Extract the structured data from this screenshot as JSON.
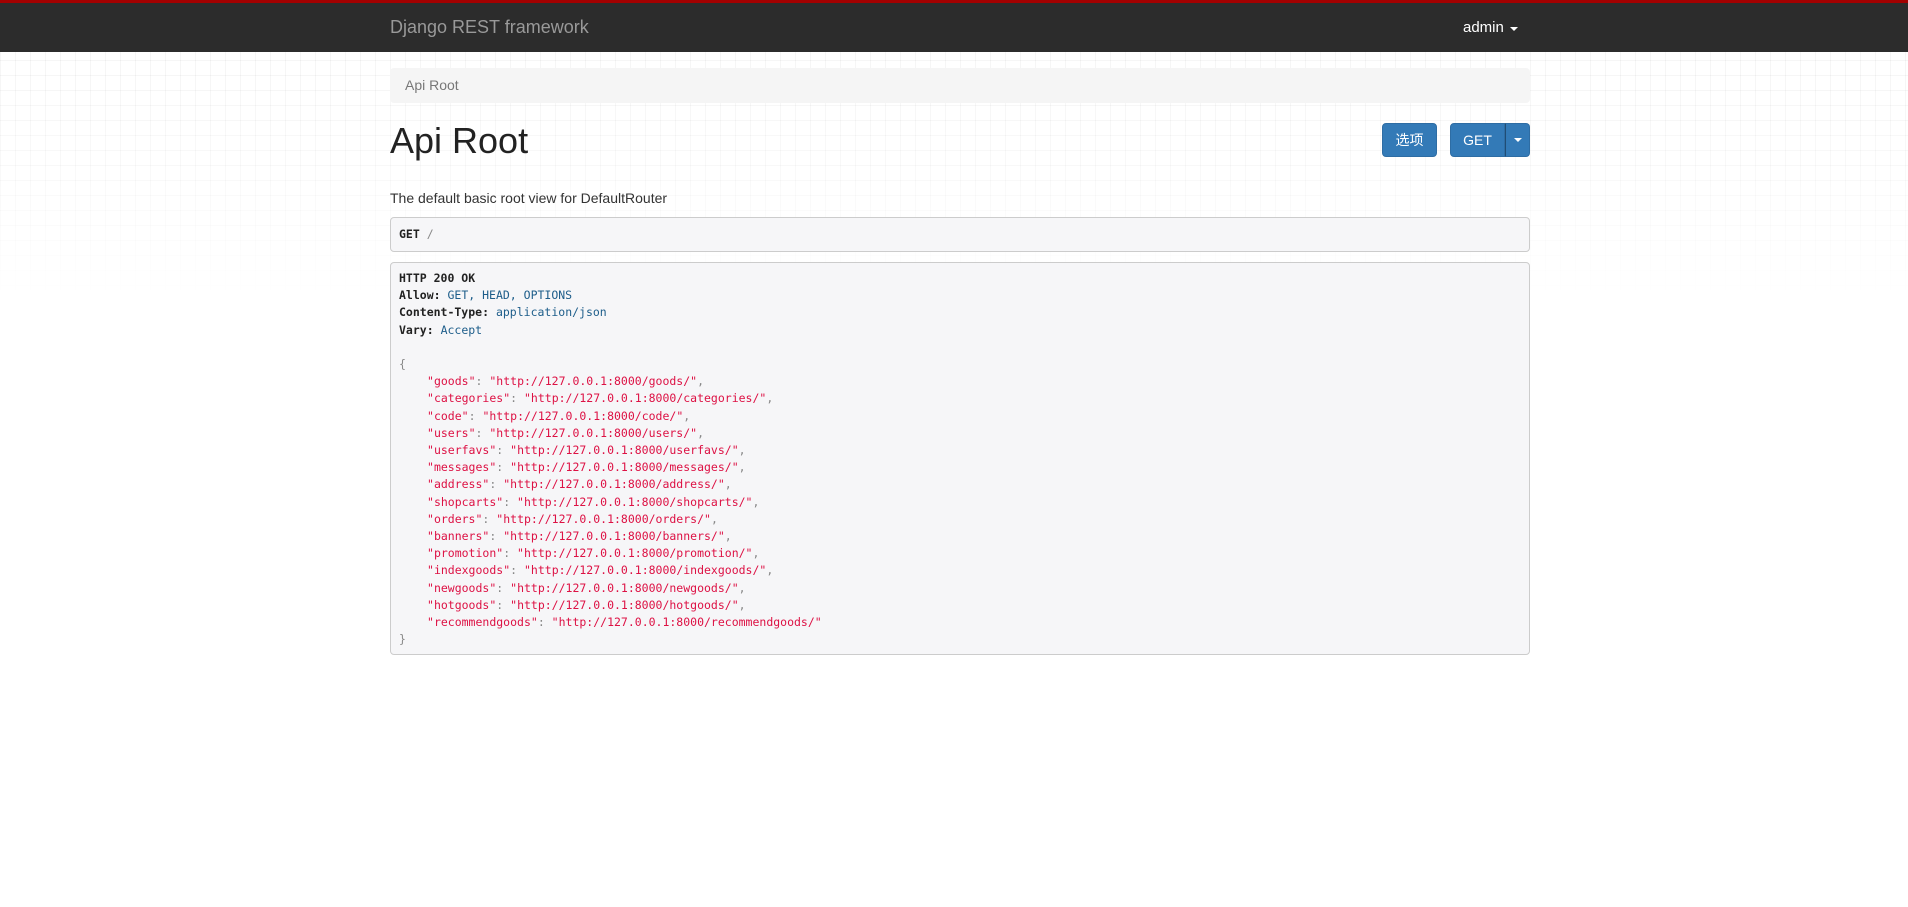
{
  "navbar": {
    "brand": "Django REST framework",
    "user": "admin"
  },
  "breadcrumb": {
    "items": [
      "Api Root"
    ]
  },
  "page": {
    "title": "Api Root",
    "description": "The default basic root view for DefaultRouter",
    "options_button": "选项",
    "get_button": "GET"
  },
  "request": {
    "method": "GET",
    "path": "/"
  },
  "response": {
    "status": "HTTP 200 OK",
    "headers": [
      {
        "name": "Allow",
        "value": "GET, HEAD, OPTIONS"
      },
      {
        "name": "Content-Type",
        "value": "application/json"
      },
      {
        "name": "Vary",
        "value": "Accept"
      }
    ],
    "json_open": "{",
    "json_close": "}",
    "entries": [
      {
        "key": "goods",
        "value": "http://127.0.0.1:8000/goods/"
      },
      {
        "key": "categories",
        "value": "http://127.0.0.1:8000/categories/"
      },
      {
        "key": "code",
        "value": "http://127.0.0.1:8000/code/"
      },
      {
        "key": "users",
        "value": "http://127.0.0.1:8000/users/"
      },
      {
        "key": "userfavs",
        "value": "http://127.0.0.1:8000/userfavs/"
      },
      {
        "key": "messages",
        "value": "http://127.0.0.1:8000/messages/"
      },
      {
        "key": "address",
        "value": "http://127.0.0.1:8000/address/"
      },
      {
        "key": "shopcarts",
        "value": "http://127.0.0.1:8000/shopcarts/"
      },
      {
        "key": "orders",
        "value": "http://127.0.0.1:8000/orders/"
      },
      {
        "key": "banners",
        "value": "http://127.0.0.1:8000/banners/"
      },
      {
        "key": "promotion",
        "value": "http://127.0.0.1:8000/promotion/"
      },
      {
        "key": "indexgoods",
        "value": "http://127.0.0.1:8000/indexgoods/"
      },
      {
        "key": "newgoods",
        "value": "http://127.0.0.1:8000/newgoods/"
      },
      {
        "key": "hotgoods",
        "value": "http://127.0.0.1:8000/hotgoods/"
      },
      {
        "key": "recommendgoods",
        "value": "http://127.0.0.1:8000/recommendgoods/"
      }
    ]
  },
  "colors": {
    "navbar_bg": "#2c2c2c",
    "navbar_accent": "#a30000",
    "primary_button": "#337ab7",
    "json_string": "#dd1144",
    "header_value": "#1d5d8a"
  },
  "icons": {
    "user_menu_caret": "caret-down-icon",
    "get_dropdown_caret": "caret-down-icon"
  }
}
